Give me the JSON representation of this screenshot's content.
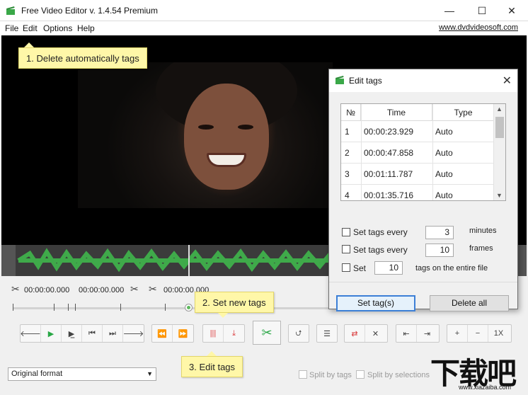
{
  "window": {
    "title": "Free Video Editor v. 1.4.54 Premium",
    "minimize": "—",
    "maximize": "☐",
    "close": "✕"
  },
  "menu": {
    "items": [
      "File",
      "Edit",
      "Options",
      "Help"
    ],
    "site_link": "www.dvdvideosoft.com"
  },
  "tooltips": {
    "delete": "1. Delete automatically tags",
    "set_new": "2. Set new tags",
    "edit": "3. Edit tags"
  },
  "timecodes": {
    "start": "00:00:00.000",
    "end": "00:00:00.000",
    "cut": "00:00:00.000"
  },
  "playback": {
    "progress": 0.54
  },
  "dialog": {
    "title": "Edit tags",
    "close": "✕",
    "columns": [
      "№",
      "Time",
      "Type"
    ],
    "rows": [
      {
        "n": "1",
        "time": "00:00:23.929",
        "type": "Auto"
      },
      {
        "n": "2",
        "time": "00:00:47.858",
        "type": "Auto"
      },
      {
        "n": "3",
        "time": "00:01:11.787",
        "type": "Auto"
      },
      {
        "n": "4",
        "time": "00:01:35.716",
        "type": "Auto"
      }
    ],
    "option1": {
      "label": "Set tags every",
      "value": "3",
      "unit": "minutes"
    },
    "option2": {
      "label": "Set tags every",
      "value": "10",
      "unit": "frames"
    },
    "option3": {
      "label": "Set",
      "value": "10",
      "unit": "tags on the entire file"
    },
    "set_button": "Set tag(s)",
    "delete_button": "Delete all"
  },
  "bottom": {
    "format": "Original format",
    "split_by_tags": "Split by tags",
    "split_by_selections": "Split by selections"
  },
  "toolbar": {
    "speed": "1X"
  },
  "watermark": {
    "big": "下载吧",
    "small": "www.xiazaiba.com"
  },
  "colors": {
    "accent_green": "#28a745",
    "waveform_green": "#3faa4a",
    "tooltip_yellow": "#fff7a8",
    "focus_blue": "#3c7fd6"
  }
}
